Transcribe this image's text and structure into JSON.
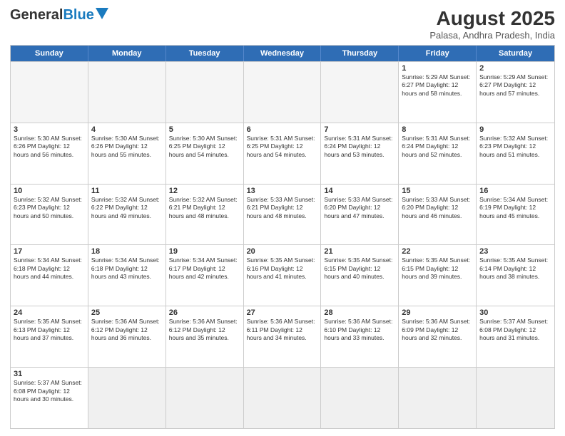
{
  "header": {
    "logo_general": "General",
    "logo_blue": "Blue",
    "month_year": "August 2025",
    "location": "Palasa, Andhra Pradesh, India"
  },
  "weekdays": [
    "Sunday",
    "Monday",
    "Tuesday",
    "Wednesday",
    "Thursday",
    "Friday",
    "Saturday"
  ],
  "rows": [
    [
      {
        "day": "",
        "info": ""
      },
      {
        "day": "",
        "info": ""
      },
      {
        "day": "",
        "info": ""
      },
      {
        "day": "",
        "info": ""
      },
      {
        "day": "",
        "info": ""
      },
      {
        "day": "1",
        "info": "Sunrise: 5:29 AM\nSunset: 6:27 PM\nDaylight: 12 hours\nand 58 minutes."
      },
      {
        "day": "2",
        "info": "Sunrise: 5:29 AM\nSunset: 6:27 PM\nDaylight: 12 hours\nand 57 minutes."
      }
    ],
    [
      {
        "day": "3",
        "info": "Sunrise: 5:30 AM\nSunset: 6:26 PM\nDaylight: 12 hours\nand 56 minutes."
      },
      {
        "day": "4",
        "info": "Sunrise: 5:30 AM\nSunset: 6:26 PM\nDaylight: 12 hours\nand 55 minutes."
      },
      {
        "day": "5",
        "info": "Sunrise: 5:30 AM\nSunset: 6:25 PM\nDaylight: 12 hours\nand 54 minutes."
      },
      {
        "day": "6",
        "info": "Sunrise: 5:31 AM\nSunset: 6:25 PM\nDaylight: 12 hours\nand 54 minutes."
      },
      {
        "day": "7",
        "info": "Sunrise: 5:31 AM\nSunset: 6:24 PM\nDaylight: 12 hours\nand 53 minutes."
      },
      {
        "day": "8",
        "info": "Sunrise: 5:31 AM\nSunset: 6:24 PM\nDaylight: 12 hours\nand 52 minutes."
      },
      {
        "day": "9",
        "info": "Sunrise: 5:32 AM\nSunset: 6:23 PM\nDaylight: 12 hours\nand 51 minutes."
      }
    ],
    [
      {
        "day": "10",
        "info": "Sunrise: 5:32 AM\nSunset: 6:23 PM\nDaylight: 12 hours\nand 50 minutes."
      },
      {
        "day": "11",
        "info": "Sunrise: 5:32 AM\nSunset: 6:22 PM\nDaylight: 12 hours\nand 49 minutes."
      },
      {
        "day": "12",
        "info": "Sunrise: 5:32 AM\nSunset: 6:21 PM\nDaylight: 12 hours\nand 48 minutes."
      },
      {
        "day": "13",
        "info": "Sunrise: 5:33 AM\nSunset: 6:21 PM\nDaylight: 12 hours\nand 48 minutes."
      },
      {
        "day": "14",
        "info": "Sunrise: 5:33 AM\nSunset: 6:20 PM\nDaylight: 12 hours\nand 47 minutes."
      },
      {
        "day": "15",
        "info": "Sunrise: 5:33 AM\nSunset: 6:20 PM\nDaylight: 12 hours\nand 46 minutes."
      },
      {
        "day": "16",
        "info": "Sunrise: 5:34 AM\nSunset: 6:19 PM\nDaylight: 12 hours\nand 45 minutes."
      }
    ],
    [
      {
        "day": "17",
        "info": "Sunrise: 5:34 AM\nSunset: 6:18 PM\nDaylight: 12 hours\nand 44 minutes."
      },
      {
        "day": "18",
        "info": "Sunrise: 5:34 AM\nSunset: 6:18 PM\nDaylight: 12 hours\nand 43 minutes."
      },
      {
        "day": "19",
        "info": "Sunrise: 5:34 AM\nSunset: 6:17 PM\nDaylight: 12 hours\nand 42 minutes."
      },
      {
        "day": "20",
        "info": "Sunrise: 5:35 AM\nSunset: 6:16 PM\nDaylight: 12 hours\nand 41 minutes."
      },
      {
        "day": "21",
        "info": "Sunrise: 5:35 AM\nSunset: 6:15 PM\nDaylight: 12 hours\nand 40 minutes."
      },
      {
        "day": "22",
        "info": "Sunrise: 5:35 AM\nSunset: 6:15 PM\nDaylight: 12 hours\nand 39 minutes."
      },
      {
        "day": "23",
        "info": "Sunrise: 5:35 AM\nSunset: 6:14 PM\nDaylight: 12 hours\nand 38 minutes."
      }
    ],
    [
      {
        "day": "24",
        "info": "Sunrise: 5:35 AM\nSunset: 6:13 PM\nDaylight: 12 hours\nand 37 minutes."
      },
      {
        "day": "25",
        "info": "Sunrise: 5:36 AM\nSunset: 6:12 PM\nDaylight: 12 hours\nand 36 minutes."
      },
      {
        "day": "26",
        "info": "Sunrise: 5:36 AM\nSunset: 6:12 PM\nDaylight: 12 hours\nand 35 minutes."
      },
      {
        "day": "27",
        "info": "Sunrise: 5:36 AM\nSunset: 6:11 PM\nDaylight: 12 hours\nand 34 minutes."
      },
      {
        "day": "28",
        "info": "Sunrise: 5:36 AM\nSunset: 6:10 PM\nDaylight: 12 hours\nand 33 minutes."
      },
      {
        "day": "29",
        "info": "Sunrise: 5:36 AM\nSunset: 6:09 PM\nDaylight: 12 hours\nand 32 minutes."
      },
      {
        "day": "30",
        "info": "Sunrise: 5:37 AM\nSunset: 6:08 PM\nDaylight: 12 hours\nand 31 minutes."
      }
    ],
    [
      {
        "day": "31",
        "info": "Sunrise: 5:37 AM\nSunset: 6:08 PM\nDaylight: 12 hours\nand 30 minutes."
      },
      {
        "day": "",
        "info": ""
      },
      {
        "day": "",
        "info": ""
      },
      {
        "day": "",
        "info": ""
      },
      {
        "day": "",
        "info": ""
      },
      {
        "day": "",
        "info": ""
      },
      {
        "day": "",
        "info": ""
      }
    ]
  ]
}
